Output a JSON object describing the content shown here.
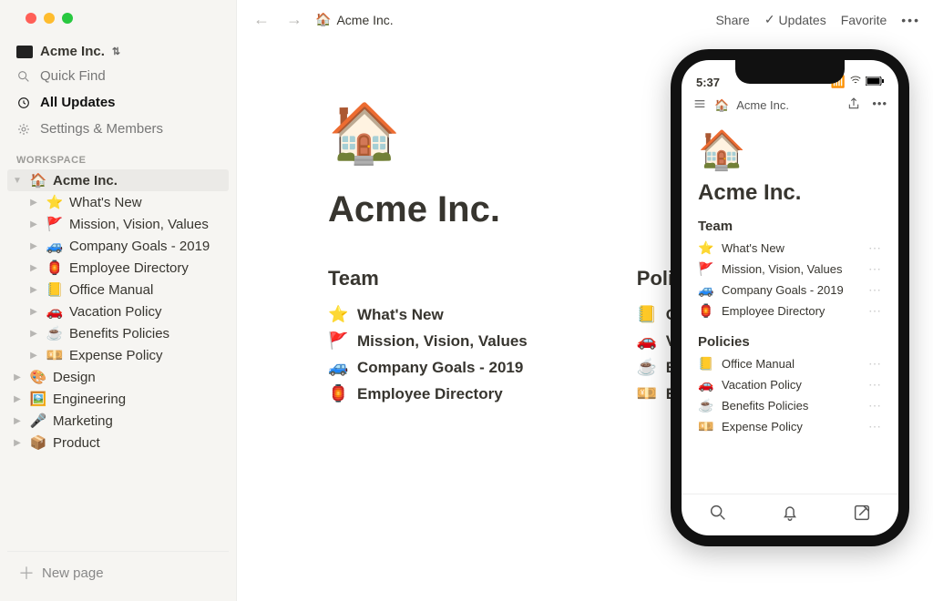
{
  "traffic_lights": [
    "close",
    "minimize",
    "zoom"
  ],
  "sidebar": {
    "workspace_name": "Acme Inc.",
    "quick": {
      "find": "Quick Find",
      "updates": "All Updates",
      "settings": "Settings & Members"
    },
    "section_label": "WORKSPACE",
    "tree": [
      {
        "icon": "🏠",
        "label": "Acme Inc.",
        "expanded": true,
        "active": true,
        "children": [
          {
            "icon": "⭐",
            "label": "What's New"
          },
          {
            "icon": "🚩",
            "label": "Mission, Vision, Values"
          },
          {
            "icon": "🚙",
            "label": "Company Goals - 2019"
          },
          {
            "icon": "🏮",
            "label": "Employee Directory"
          },
          {
            "icon": "📒",
            "label": "Office Manual"
          },
          {
            "icon": "🚗",
            "label": "Vacation Policy"
          },
          {
            "icon": "☕",
            "label": "Benefits Policies"
          },
          {
            "icon": "💴",
            "label": "Expense Policy"
          }
        ]
      },
      {
        "icon": "🎨",
        "label": "Design"
      },
      {
        "icon": "🖼️",
        "label": "Engineering"
      },
      {
        "icon": "🎤",
        "label": "Marketing"
      },
      {
        "icon": "📦",
        "label": "Product"
      }
    ],
    "new_page": "New page"
  },
  "topbar": {
    "breadcrumb_icon": "🏠",
    "breadcrumb": "Acme Inc.",
    "share": "Share",
    "updates": "Updates",
    "favorite": "Favorite"
  },
  "page": {
    "icon": "🏠",
    "title": "Acme Inc.",
    "columns": [
      {
        "heading": "Team",
        "links": [
          {
            "icon": "⭐",
            "label": "What's New"
          },
          {
            "icon": "🚩",
            "label": "Mission, Vision, Values"
          },
          {
            "icon": "🚙",
            "label": "Company Goals - 2019"
          },
          {
            "icon": "🏮",
            "label": "Employee Directory"
          }
        ]
      },
      {
        "heading": "Policies",
        "links": [
          {
            "icon": "📒",
            "label": "Office Manual"
          },
          {
            "icon": "🚗",
            "label": "Vacation Policy"
          },
          {
            "icon": "☕",
            "label": "Benefits Policies"
          },
          {
            "icon": "💴",
            "label": "Expense Policy"
          }
        ]
      }
    ]
  },
  "phone": {
    "time": "5:37",
    "breadcrumb_icon": "🏠",
    "breadcrumb": "Acme Inc.",
    "icon": "🏠",
    "title": "Acme Inc.",
    "sections": [
      {
        "heading": "Team",
        "links": [
          {
            "icon": "⭐",
            "label": "What's New"
          },
          {
            "icon": "🚩",
            "label": "Mission, Vision, Values"
          },
          {
            "icon": "🚙",
            "label": "Company Goals - 2019"
          },
          {
            "icon": "🏮",
            "label": "Employee Directory"
          }
        ]
      },
      {
        "heading": "Policies",
        "links": [
          {
            "icon": "📒",
            "label": "Office Manual"
          },
          {
            "icon": "🚗",
            "label": "Vacation Policy"
          },
          {
            "icon": "☕",
            "label": "Benefits Policies"
          },
          {
            "icon": "💴",
            "label": "Expense Policy"
          }
        ]
      }
    ]
  }
}
